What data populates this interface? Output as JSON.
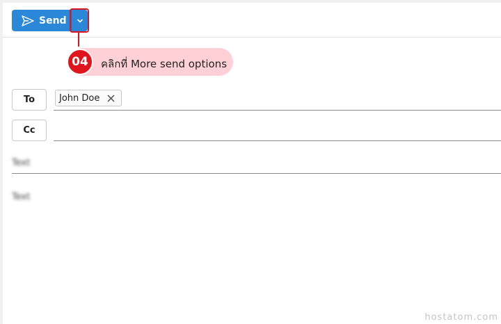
{
  "toolbar": {
    "send_label": "Send",
    "send_icon": "send-plane-icon",
    "more_icon": "chevron-down-icon",
    "accent_color": "#2b88d8"
  },
  "annotation": {
    "step": "04",
    "text": "คลิกที่ More send options",
    "color": "#e0141c"
  },
  "recipients": {
    "to_label": "To",
    "cc_label": "Cc",
    "to_chips": [
      {
        "name": "John Doe"
      }
    ]
  },
  "subject": {
    "placeholder": "Text"
  },
  "body": {
    "placeholder": "Text"
  },
  "watermark": "hostatom.com"
}
